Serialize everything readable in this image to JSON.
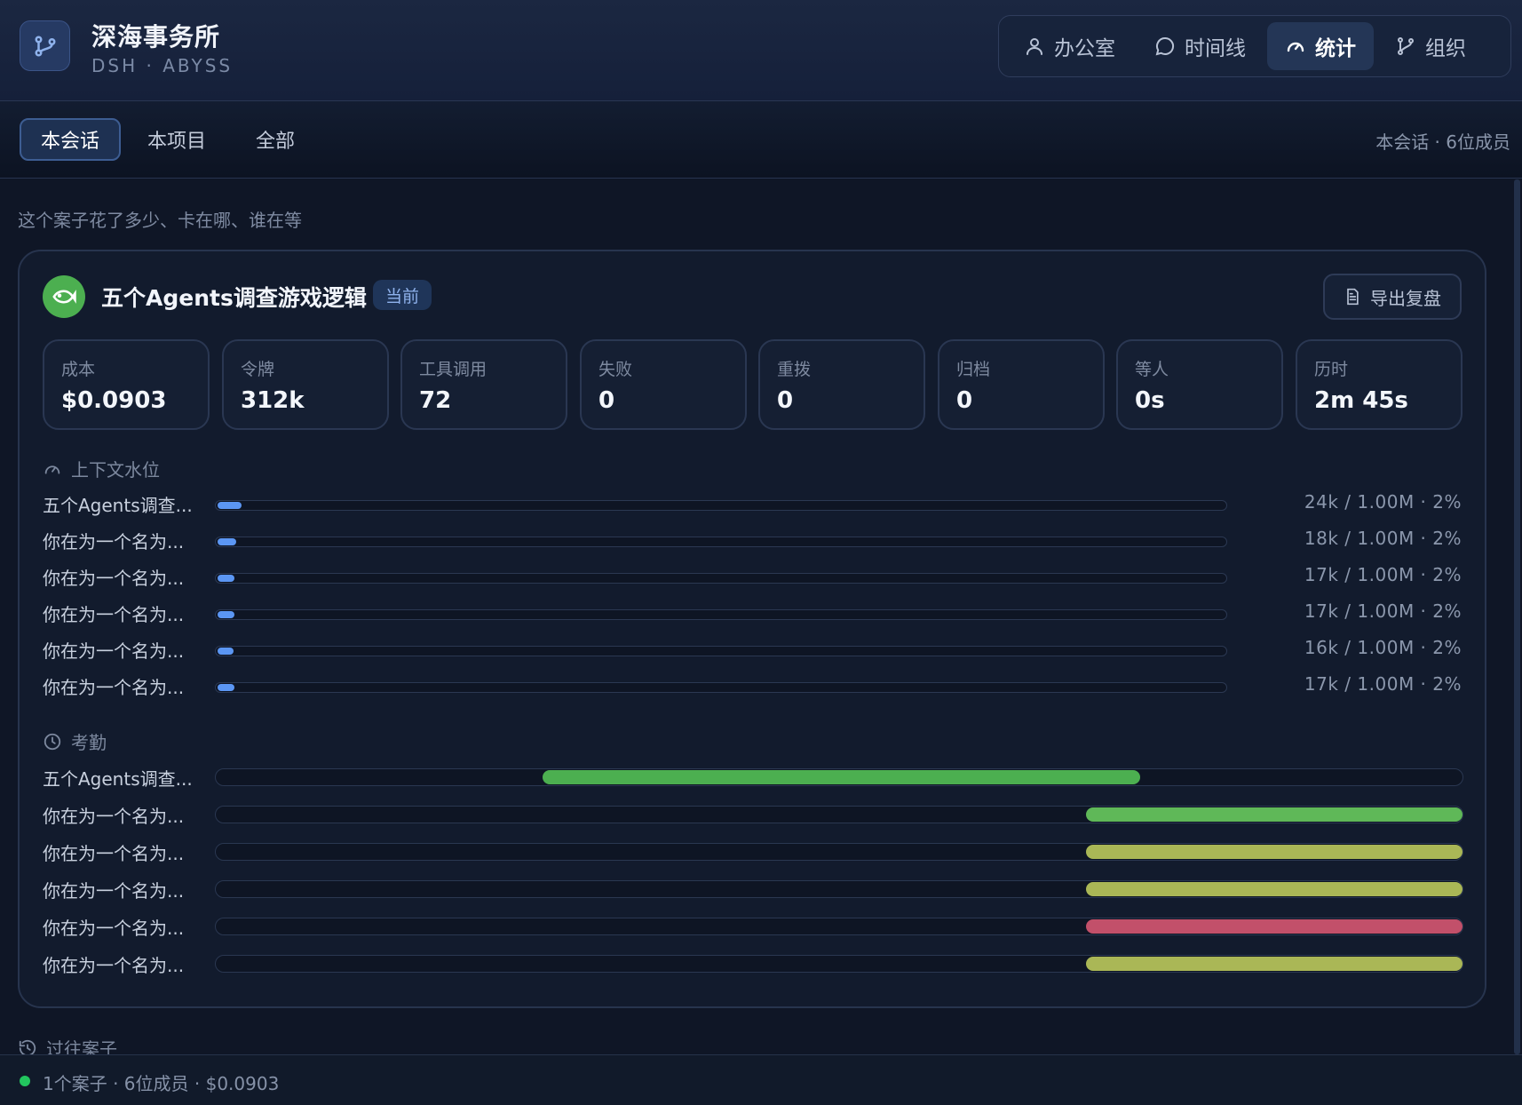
{
  "brand": {
    "title": "深海事务所",
    "subtitle": "DSH · ABYSS"
  },
  "nav": [
    {
      "label": "办公室",
      "icon": "user-icon"
    },
    {
      "label": "时间线",
      "icon": "chat-bubble-icon"
    },
    {
      "label": "统计",
      "icon": "gauge-icon",
      "active": true
    },
    {
      "label": "组织",
      "icon": "branch-icon"
    }
  ],
  "tabs": [
    {
      "label": "本会话",
      "active": true
    },
    {
      "label": "本项目"
    },
    {
      "label": "全部"
    }
  ],
  "tab_meta": "本会话 · 6位成员",
  "subtitle": "这个案子花了多少、卡在哪、谁在等",
  "case": {
    "title": "五个Agents调查游戏逻辑",
    "badge": "当前",
    "export_label": "导出复盘",
    "stats": [
      {
        "label": "成本",
        "value": "$0.0903"
      },
      {
        "label": "令牌",
        "value": "312k"
      },
      {
        "label": "工具调用",
        "value": "72"
      },
      {
        "label": "失败",
        "value": "0"
      },
      {
        "label": "重拨",
        "value": "0"
      },
      {
        "label": "归档",
        "value": "0"
      },
      {
        "label": "等人",
        "value": "0s"
      },
      {
        "label": "历时",
        "value": "2m 45s"
      }
    ],
    "context_title": "上下文水位",
    "context_rows": [
      {
        "label": "五个Agents调查...",
        "value": "24k / 1.00M · 2%",
        "fraction": 0.024
      },
      {
        "label": "你在为一个名为...",
        "value": "18k / 1.00M · 2%",
        "fraction": 0.018
      },
      {
        "label": "你在为一个名为...",
        "value": "17k / 1.00M · 2%",
        "fraction": 0.017
      },
      {
        "label": "你在为一个名为...",
        "value": "17k / 1.00M · 2%",
        "fraction": 0.017
      },
      {
        "label": "你在为一个名为...",
        "value": "16k / 1.00M · 2%",
        "fraction": 0.016
      },
      {
        "label": "你在为一个名为...",
        "value": "17k / 1.00M · 2%",
        "fraction": 0.017
      }
    ],
    "attendance_title": "考勤",
    "attendance_rows": [
      {
        "label": "五个Agents调查...",
        "start": 0.262,
        "end": 0.741,
        "color": "#4caf50"
      },
      {
        "label": "你在为一个名为...",
        "start": 0.698,
        "end": 1.0,
        "color": "#5fb858"
      },
      {
        "label": "你在为一个名为...",
        "start": 0.698,
        "end": 1.0,
        "color": "#aab756"
      },
      {
        "label": "你在为一个名为...",
        "start": 0.698,
        "end": 1.0,
        "color": "#aab756"
      },
      {
        "label": "你在为一个名为...",
        "start": 0.698,
        "end": 1.0,
        "color": "#c2506a"
      },
      {
        "label": "你在为一个名为...",
        "start": 0.698,
        "end": 1.0,
        "color": "#aab756"
      }
    ]
  },
  "past_title": "过往案子",
  "footer": "1个案子 · 6位成员 · $0.0903"
}
